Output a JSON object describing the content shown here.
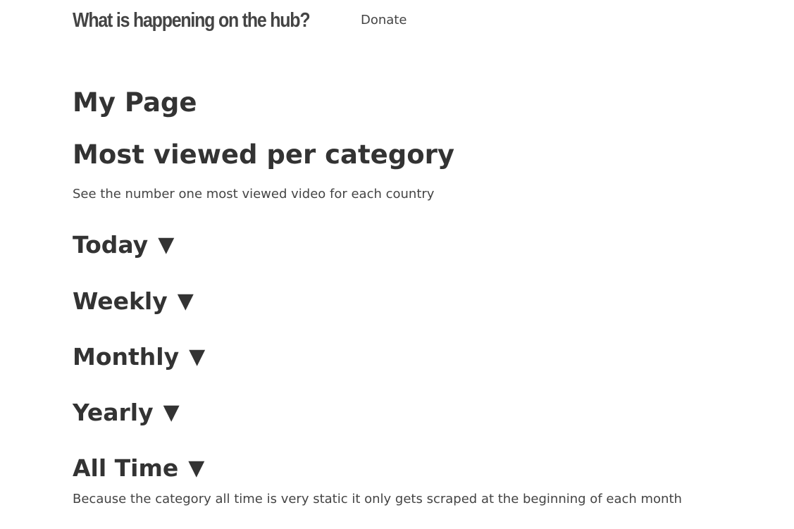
{
  "navbar": {
    "brand": "What is happening on the hub?",
    "donate_label": "Donate"
  },
  "main": {
    "page_title": "My Page",
    "section_title": "Most viewed per category",
    "subtitle": "See the number one most viewed video for each country",
    "periods": [
      {
        "label": "Today",
        "arrow": "▼"
      },
      {
        "label": "Weekly",
        "arrow": "▼"
      },
      {
        "label": "Monthly",
        "arrow": "▼"
      },
      {
        "label": "Yearly",
        "arrow": "▼"
      },
      {
        "label": "All Time",
        "arrow": "▼"
      }
    ],
    "footnote": "Because the category all time is very static it only gets scraped at the beginning of each month"
  },
  "colors": {
    "text": "#333333",
    "background": "#ffffff"
  }
}
